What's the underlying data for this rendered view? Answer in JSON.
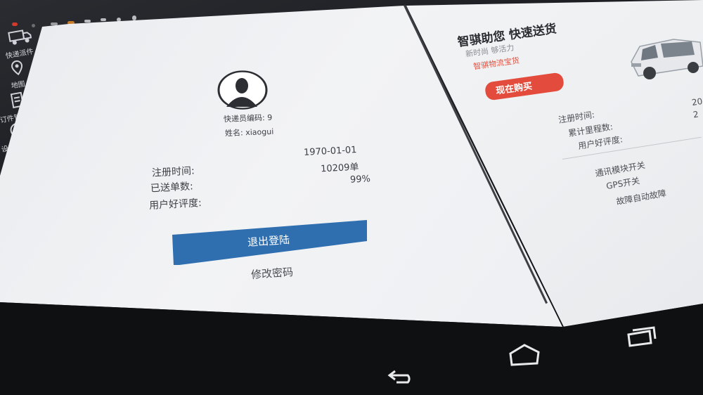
{
  "sidebar": {
    "items": [
      {
        "label": "快递派件",
        "icon": "truck-icon"
      },
      {
        "label": "地图",
        "icon": "map-pin-icon"
      },
      {
        "label": "订件管理",
        "icon": "document-icon"
      },
      {
        "label": "设置",
        "icon": "dashboard-icon"
      }
    ]
  },
  "profile": {
    "courier_id": "快递员编码: 9",
    "name": "姓名: xiaogui",
    "register_label": "注册时间:",
    "register_value": "1970-01-01",
    "orders_label": "已送单数:",
    "orders_value": "10209单",
    "rating_label": "用户好评度:",
    "rating_value": "99%",
    "logout_button": "退出登陆",
    "change_password": "修改密码"
  },
  "promo": {
    "title": "智骐助您 快速送货",
    "subtitle": "新时尚  够活力",
    "brand": "智骐物流宝货",
    "buy_button": "现在购买",
    "stats": [
      {
        "label": "注册时间:",
        "value": "20"
      },
      {
        "label": "累计里程数:",
        "value": "2"
      },
      {
        "label": "用户好评度:",
        "value": ""
      }
    ],
    "toggles": [
      "通讯模块开关",
      "GPS开关",
      "故障自动故障"
    ]
  },
  "navbar": {
    "icons": [
      "back-icon",
      "home-icon",
      "recent-apps-icon"
    ]
  },
  "colors": {
    "accent": "#2f6fb0",
    "promo_red": "#e34c3c",
    "status_red": "#d33a2c"
  }
}
